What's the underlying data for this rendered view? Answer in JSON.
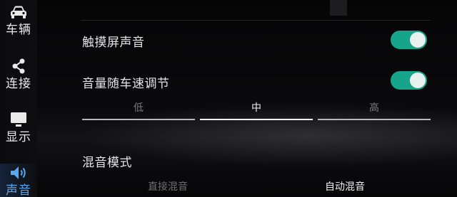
{
  "sidebar": {
    "items": [
      {
        "label": "车辆",
        "icon": "car-icon"
      },
      {
        "label": "连接",
        "icon": "share-icon"
      },
      {
        "label": "显示",
        "icon": "monitor-icon"
      },
      {
        "label": "声音",
        "icon": "speaker-icon",
        "active": true
      }
    ]
  },
  "settings": {
    "touch_sound": {
      "label": "触摸屏声音",
      "enabled": true
    },
    "speed_volume": {
      "label": "音量随车速调节",
      "enabled": true
    },
    "speed_levels": {
      "options": [
        "低",
        "中",
        "高"
      ],
      "selected": "中"
    },
    "mix_mode": {
      "label": "混音模式",
      "options": [
        "直接混音",
        "自动混音"
      ],
      "selected": "自动混音"
    }
  },
  "colors": {
    "toggle_on": "#16a58a",
    "active_nav": "#5aa9f0"
  }
}
